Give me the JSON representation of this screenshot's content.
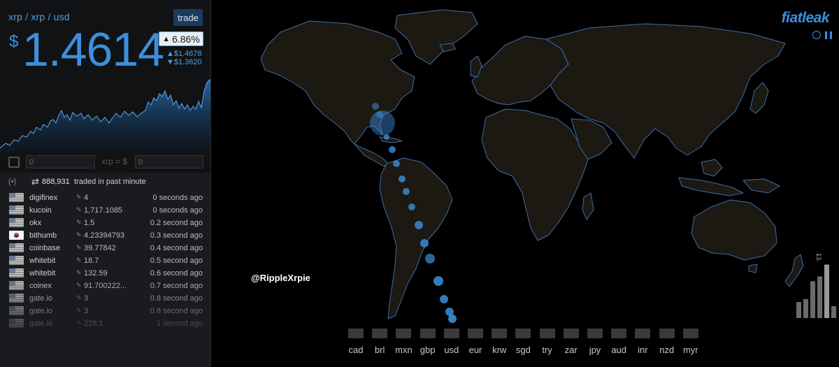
{
  "ticker": {
    "pair": "xrp / xrp / usd",
    "trade_button": "trade",
    "currency_symbol": "$",
    "price": "1.4614",
    "change": "6.86%",
    "high": "$1.4678",
    "low": "$1.3620",
    "accent_color": "#3c8fdc"
  },
  "converter": {
    "input_a_value": "0",
    "equals_label": "xrp = $",
    "input_b_value": "0"
  },
  "trades": {
    "count": "888,931",
    "label": "traded in past minute",
    "rows": [
      {
        "flag": "us",
        "exchange": "digifinex",
        "amount": "4",
        "time": "0 seconds ago"
      },
      {
        "flag": "us",
        "exchange": "kucoin",
        "amount": "1,717.1085",
        "time": "0 seconds ago"
      },
      {
        "flag": "us",
        "exchange": "okx",
        "amount": "1.5",
        "time": "0.2 second ago"
      },
      {
        "flag": "kr",
        "exchange": "bithumb",
        "amount": "4.23394793",
        "time": "0.3 second ago"
      },
      {
        "flag": "us",
        "exchange": "coinbase",
        "amount": "39.77842",
        "time": "0.4 second ago"
      },
      {
        "flag": "us",
        "exchange": "whitebit",
        "amount": "18.7",
        "time": "0.5 second ago"
      },
      {
        "flag": "us",
        "exchange": "whitebit",
        "amount": "132.59",
        "time": "0.6 second ago"
      },
      {
        "flag": "us",
        "exchange": "coinex",
        "amount": "91.700222...",
        "time": "0.7 second ago"
      },
      {
        "flag": "us",
        "exchange": "gate.io",
        "amount": "3",
        "time": "0.8 second ago"
      },
      {
        "flag": "us",
        "exchange": "gate.io",
        "amount": "3",
        "time": "0.8 second ago"
      },
      {
        "flag": "us",
        "exchange": "gate.io",
        "amount": "228.1",
        "time": "1 second ago"
      }
    ]
  },
  "map": {
    "brand": "fiatleak",
    "watermark": "@RippleXrpie",
    "currencies": [
      "cad",
      "brl",
      "mxn",
      "gbp",
      "usd",
      "eur",
      "krw",
      "sgd",
      "try",
      "zar",
      "jpy",
      "aud",
      "inr",
      "nzd",
      "myr"
    ],
    "volume_label": "13.",
    "volume_levels": [
      0.27,
      0.32,
      0.62,
      0.7,
      0.9,
      0.2
    ]
  },
  "icons": {
    "calculator": "calculator-icon",
    "radio": "broadcast-icon",
    "arrows": "exchange-arrows-icon",
    "globe": "globe-icon",
    "pause": "pause-icon"
  }
}
